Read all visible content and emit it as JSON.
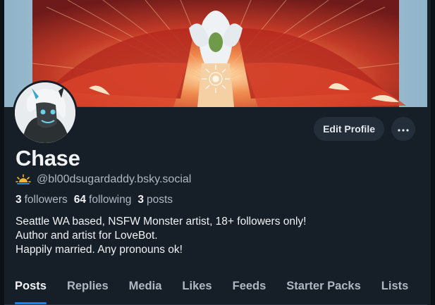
{
  "profile": {
    "display_name": "Chase",
    "handle": "@bl00dsugardaddy.bsky.social",
    "stats": {
      "followers_count": "3",
      "followers_label": "followers",
      "following_count": "64",
      "following_label": "following",
      "posts_count": "3",
      "posts_label": "posts"
    },
    "bio": [
      "Seattle WA based, NSFW Monster artist, 18+ followers only!",
      "Author and artist for LoveBot.",
      "Happily married. Any pronouns ok!"
    ]
  },
  "actions": {
    "edit_profile_label": "Edit Profile",
    "more_icon": "ellipsis-icon"
  },
  "handle_badge_icon": "sunrise-icon",
  "tabs": [
    {
      "label": "Posts",
      "active": true
    },
    {
      "label": "Replies",
      "active": false
    },
    {
      "label": "Media",
      "active": false
    },
    {
      "label": "Likes",
      "active": false
    },
    {
      "label": "Feeds",
      "active": false
    },
    {
      "label": "Starter Packs",
      "active": false
    },
    {
      "label": "Lists",
      "active": false
    }
  ],
  "colors": {
    "background": "#161e27",
    "accent": "#1185fe",
    "button_bg": "#242e3a",
    "muted_text": "#aeb8c2"
  }
}
